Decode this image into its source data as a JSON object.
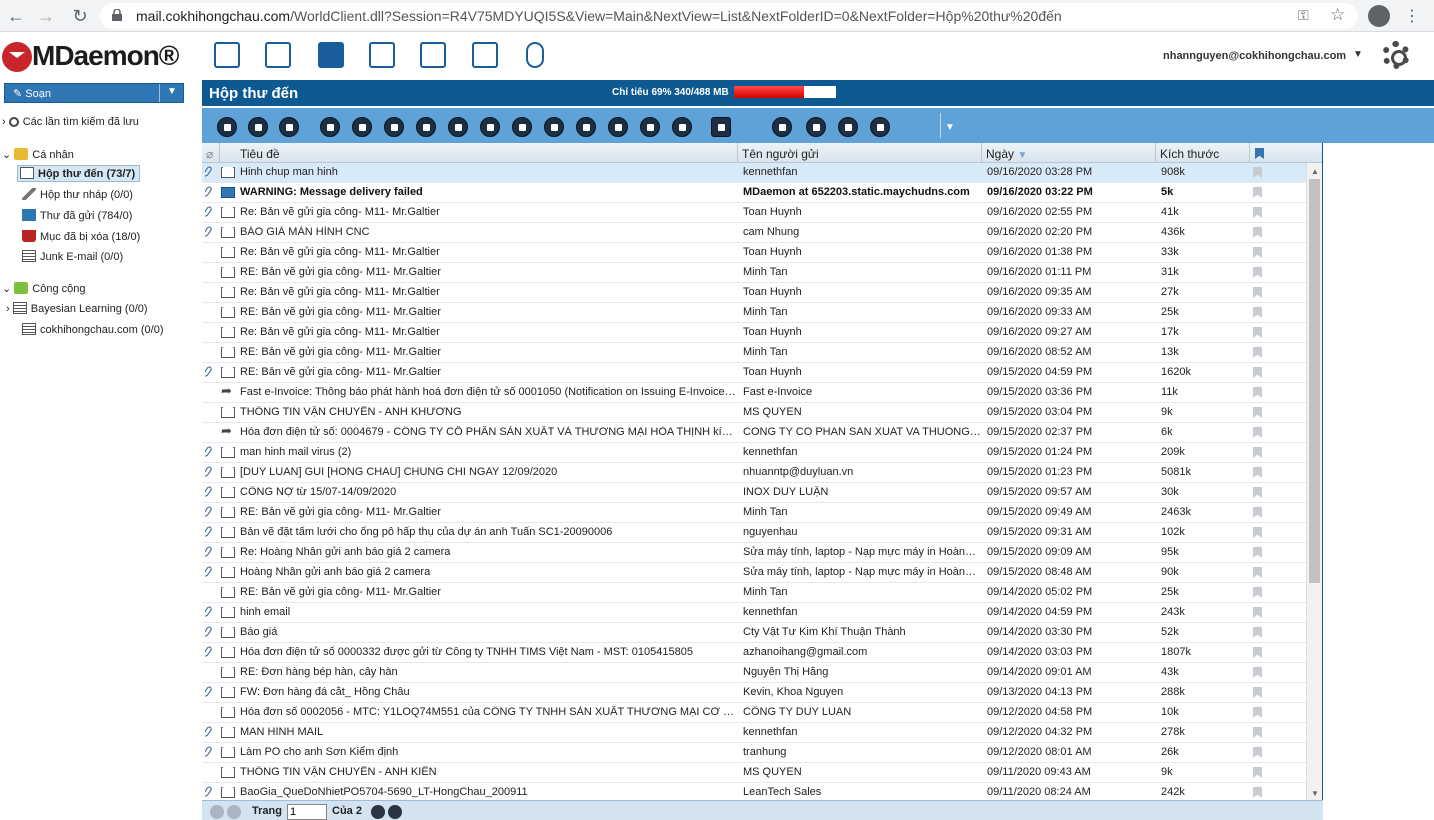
{
  "browser": {
    "url_host": "mail.cokhihongchau.com",
    "url_path": "/WorldClient.dll?Session=R4V75MDYUQI5S&View=Main&NextView=List&NextFolderID=0&NextFolder=Hộp%20thư%20đến"
  },
  "app": {
    "logo_text": "MDaemon®",
    "user_email": "nhannguyen@cokhihongchau.com"
  },
  "sidebar": {
    "compose_label": "Soạn",
    "saved_searches": "Các lần tìm kiếm đã lưu",
    "personal_label": "Cá nhân",
    "personal_items": [
      {
        "label": "Hộp thư đến (73/7)"
      },
      {
        "label": "Hộp thư nháp (0/0)"
      },
      {
        "label": "Thư đã gửi (784/0)"
      },
      {
        "label": "Mục đã bị xóa (18/0)"
      },
      {
        "label": "Junk E-mail (0/0)"
      }
    ],
    "public_label": "Công cộng",
    "public_items": [
      {
        "label": "Bayesian Learning (0/0)"
      },
      {
        "label": "cokhihongchau.com (0/0)"
      }
    ]
  },
  "folder": {
    "title": "Hộp thư đến",
    "quota_label": "Chỉ tiêu 69% 340/488 MB",
    "quota_percent": 69
  },
  "columns": {
    "subject": "Tiêu đề",
    "from": "Tên người gửi",
    "date": "Ngày",
    "size": "Kích thước"
  },
  "messages": [
    {
      "subject": "Hinh chup man hinh",
      "from": "kennethfan",
      "date": "09/16/2020 03:28 PM",
      "size": "908k",
      "att": true,
      "icon": "open",
      "selected": true
    },
    {
      "subject": "WARNING: Message delivery failed",
      "from": "MDaemon at 652203.static.maychudns.com",
      "date": "09/16/2020 03:22 PM",
      "size": "5k",
      "att": true,
      "icon": "closed",
      "unread": true
    },
    {
      "subject": "Re: Bản vẽ gửi gia công- M11- Mr.Galtier",
      "from": "Toan Huynh",
      "date": "09/16/2020 02:55 PM",
      "size": "41k",
      "att": true,
      "icon": "open"
    },
    {
      "subject": "BÁO GIÁ MÀN HÌNH CNC",
      "from": "cam Nhung",
      "date": "09/16/2020 02:20 PM",
      "size": "436k",
      "att": true,
      "icon": "open"
    },
    {
      "subject": "Re: Bản vẽ gửi gia công- M11- Mr.Galtier",
      "from": "Toan Huynh",
      "date": "09/16/2020 01:38 PM",
      "size": "33k",
      "att": false,
      "icon": "open"
    },
    {
      "subject": "RE: Bản vẽ gửi gia công- M11- Mr.Galtier",
      "from": "Minh Tan",
      "date": "09/16/2020 01:11 PM",
      "size": "31k",
      "att": false,
      "icon": "open"
    },
    {
      "subject": "Re: Bản vẽ gửi gia công- M11- Mr.Galtier",
      "from": "Toan Huynh",
      "date": "09/16/2020 09:35 AM",
      "size": "27k",
      "att": false,
      "icon": "open"
    },
    {
      "subject": "RE: Bản vẽ gửi gia công- M11- Mr.Galtier",
      "from": "Minh Tan",
      "date": "09/16/2020 09:33 AM",
      "size": "25k",
      "att": false,
      "icon": "open"
    },
    {
      "subject": "Re: Bản vẽ gửi gia công- M11- Mr.Galtier",
      "from": "Toan Huynh",
      "date": "09/16/2020 09:27 AM",
      "size": "17k",
      "att": false,
      "icon": "open"
    },
    {
      "subject": "RE: Bản vẽ gửi gia công- M11- Mr.Galtier",
      "from": "Minh Tan",
      "date": "09/16/2020 08:52 AM",
      "size": "13k",
      "att": false,
      "icon": "open"
    },
    {
      "subject": "RE: Bản vẽ gửi gia công- M11- Mr.Galtier",
      "from": "Toan Huynh",
      "date": "09/15/2020 04:59 PM",
      "size": "1620k",
      "att": true,
      "icon": "open"
    },
    {
      "subject": "Fast e-Invoice: Thông báo phát hành hoá đơn điện tử số 0001050 (Notification on Issuing E-Invoices N...",
      "from": "Fast e-Invoice",
      "date": "09/15/2020 03:36 PM",
      "size": "11k",
      "att": false,
      "icon": "fwd"
    },
    {
      "subject": "THÔNG TIN VẬN CHUYỂN - ANH KHƯƠNG",
      "from": "MS QUYEN",
      "date": "09/15/2020 03:04 PM",
      "size": "9k",
      "att": false,
      "icon": "open"
    },
    {
      "subject": "Hóa đơn điện tử số: 0004679 - CÔNG TY CỔ PHẦN SẢN XUẤT VÀ THƯƠNG MẠI HÒA THỊNH kính gửi k...",
      "from": "CONG TY CO PHAN SAN XUAT VA THUONG MAI...",
      "date": "09/15/2020 02:37 PM",
      "size": "6k",
      "att": false,
      "icon": "fwd"
    },
    {
      "subject": "man hinh mail virus (2)",
      "from": "kennethfan",
      "date": "09/15/2020 01:24 PM",
      "size": "209k",
      "att": true,
      "icon": "open"
    },
    {
      "subject": "[DUY LUAN] GUI [HONG CHAU] CHUNG CHI NGAY 12/09/2020",
      "from": "nhuanntp@duyluan.vn",
      "date": "09/15/2020 01:23 PM",
      "size": "5081k",
      "att": true,
      "icon": "open"
    },
    {
      "subject": "CÔNG NỢ từ 15/07-14/09/2020",
      "from": "INOX DUY LUẬN",
      "date": "09/15/2020 09:57 AM",
      "size": "30k",
      "att": true,
      "icon": "open"
    },
    {
      "subject": "RE: Bản vẽ gửi gia công- M11- Mr.Galtier",
      "from": "Minh Tan",
      "date": "09/15/2020 09:49 AM",
      "size": "2463k",
      "att": true,
      "icon": "open"
    },
    {
      "subject": "Bản vẽ đặt tấm lưới cho ống pô hấp thụ của dự án anh Tuấn SC1-20090006",
      "from": "nguyenhau",
      "date": "09/15/2020 09:31 AM",
      "size": "102k",
      "att": true,
      "icon": "open"
    },
    {
      "subject": "Re: Hoàng Nhân gửi anh báo giá 2 camera",
      "from": "Sửa máy tính, laptop - Nạp mực máy in Hoàng ...",
      "date": "09/15/2020 09:09 AM",
      "size": "95k",
      "att": true,
      "icon": "open"
    },
    {
      "subject": "Hoàng Nhân gửi anh báo giá 2 camera",
      "from": "Sửa máy tính, laptop - Nạp mực máy in Hoàng ...",
      "date": "09/15/2020 08:48 AM",
      "size": "90k",
      "att": true,
      "icon": "open"
    },
    {
      "subject": "RE: Bản vẽ gửi gia công- M11- Mr.Galtier",
      "from": "Minh Tan",
      "date": "09/14/2020 05:02 PM",
      "size": "25k",
      "att": false,
      "icon": "open"
    },
    {
      "subject": "hinh email",
      "from": "kennethfan",
      "date": "09/14/2020 04:59 PM",
      "size": "243k",
      "att": true,
      "icon": "open"
    },
    {
      "subject": "Báo giá",
      "from": "Cty Vật Tư Kim Khí Thuận Thành",
      "date": "09/14/2020 03:30 PM",
      "size": "52k",
      "att": true,
      "icon": "open"
    },
    {
      "subject": "Hóa đơn điện tử số 0000332 được gửi từ Công ty TNHH TIMS Việt Nam - MST: 0105415805",
      "from": "azhanoihang@gmail.com",
      "date": "09/14/2020 03:03 PM",
      "size": "1807k",
      "att": true,
      "icon": "open"
    },
    {
      "subject": "RE: Đơn hàng bép hàn, cây hàn",
      "from": "Nguyễn Thị Hằng",
      "date": "09/14/2020 09:01 AM",
      "size": "43k",
      "att": false,
      "icon": "open"
    },
    {
      "subject": "FW: Đơn hàng đá cắt_ Hồng Châu",
      "from": "Kevin, Khoa Nguyen",
      "date": "09/13/2020 04:13 PM",
      "size": "288k",
      "att": true,
      "icon": "open"
    },
    {
      "subject": "Hóa đơn số 0002056 - MTC: Y1LOQ74M551 của CÔNG TY TNHH SẢN XUẤT THƯƠNG MẠI CƠ KHÍ HỒ...",
      "from": "CÔNG TY DUY LUAN",
      "date": "09/12/2020 04:58 PM",
      "size": "10k",
      "att": false,
      "icon": "open"
    },
    {
      "subject": "MAN HINH MAIL",
      "from": "kennethfan",
      "date": "09/12/2020 04:32 PM",
      "size": "278k",
      "att": true,
      "icon": "open"
    },
    {
      "subject": "Làm PO cho anh Sơn Kiểm định",
      "from": "tranhung",
      "date": "09/12/2020 08:01 AM",
      "size": "26k",
      "att": true,
      "icon": "open"
    },
    {
      "subject": "THÔNG TIN VẬN CHUYỂN - ANH KIÊN",
      "from": "MS QUYEN",
      "date": "09/11/2020 09:43 AM",
      "size": "9k",
      "att": false,
      "icon": "open"
    },
    {
      "subject": "BaoGia_QueDoNhietPO5704-5690_LT-HongChau_200911",
      "from": "LeanTech Sales",
      "date": "09/11/2020 08:24 AM",
      "size": "242k",
      "att": true,
      "icon": "open"
    }
  ],
  "pager": {
    "page_label": "Trang",
    "page_value": "1",
    "of_label": "Của 2"
  }
}
